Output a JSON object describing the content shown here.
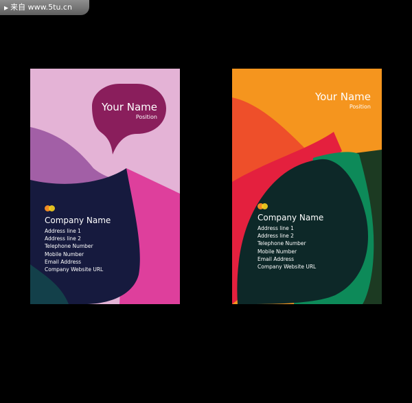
{
  "watermark": {
    "text": "来自 www.5tu.cn"
  },
  "cards": [
    {
      "your_name": "Your Name",
      "position": "Position",
      "company_name": "Company Name",
      "address_line_1": "Address line 1",
      "address_line_2": "Address line 2",
      "telephone": "Telephone Number",
      "mobile": "Mobile Number",
      "email": "Email Address",
      "website": "Company Website URL"
    },
    {
      "your_name": "Your Name",
      "position": "Position",
      "company_name": "Company Name",
      "address_line_1": "Address line 1",
      "address_line_2": "Address line 2",
      "telephone": "Telephone Number",
      "mobile": "Mobile Number",
      "email": "Email Address",
      "website": "Company Website URL"
    }
  ],
  "colors": {
    "background": "#000000",
    "card1_light_pink": "#e4b3d6",
    "card1_purple": "#a25fa6",
    "card1_magenta": "#de3f9c",
    "card1_bubble": "#8a1e5c",
    "card1_navy": "#161a3e",
    "card1_teal": "#13404a",
    "card2_orange": "#f5951e",
    "card2_red_orange": "#ee4f2a",
    "card2_red": "#e4203e",
    "card2_green": "#0d8a59",
    "card2_dark_green": "#1c3a22",
    "card2_dark": "#0d2828",
    "logo_orange": "#f08a24",
    "logo_yellow": "#f7d11e"
  }
}
